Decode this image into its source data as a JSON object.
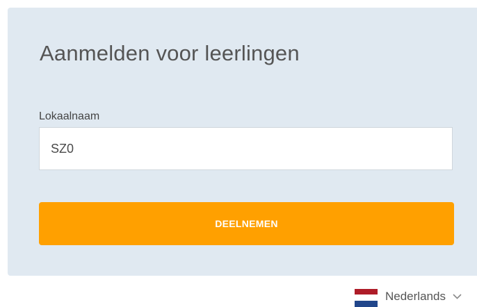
{
  "login": {
    "title": "Aanmelden voor leerlingen",
    "room_label": "Lokaalnaam",
    "room_value": "SZ0",
    "join_label": "DEELNEMEN"
  },
  "language": {
    "label": "Nederlands",
    "flag_icon": "netherlands-flag-icon",
    "dropdown_icon": "chevron-down-icon"
  },
  "colors": {
    "card_background": "#e0e9f1",
    "join_button": "#ffa000",
    "flag_red": "#ae1c28",
    "flag_white": "#ffffff",
    "flag_blue": "#21468b"
  }
}
